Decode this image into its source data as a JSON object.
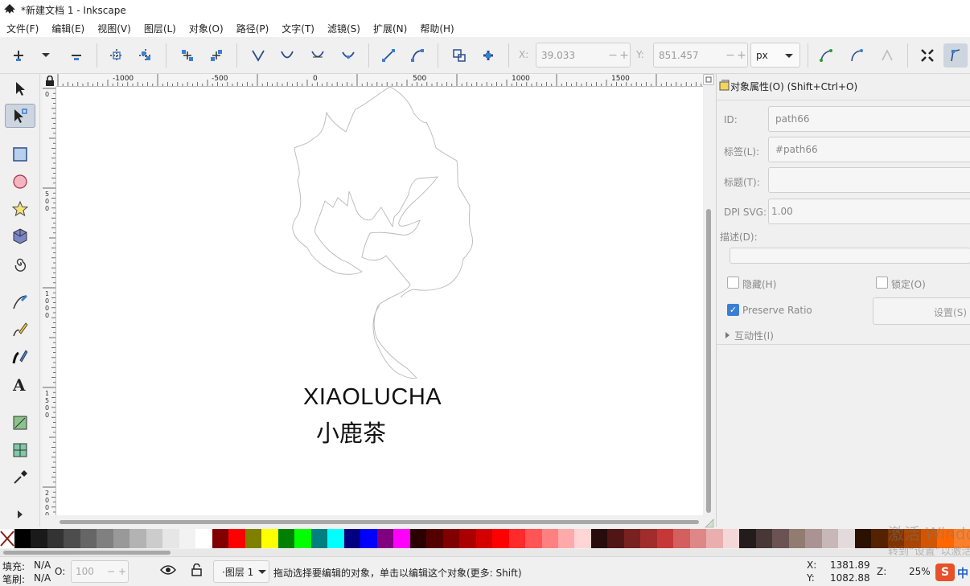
{
  "window": {
    "title": "*新建文档 1 - Inkscape"
  },
  "menu": [
    "文件(F)",
    "编辑(E)",
    "视图(V)",
    "图层(L)",
    "对象(O)",
    "路径(P)",
    "文字(T)",
    "滤镜(S)",
    "扩展(N)",
    "帮助(H)"
  ],
  "toolbar": {
    "x_label": "X:",
    "x_value": "39.033",
    "y_label": "Y:",
    "y_value": "851.457",
    "unit": "px",
    "spin_minus": "−",
    "spin_plus": "+"
  },
  "ruler": {
    "h_ticks": [
      "-1000",
      "-500",
      "0",
      "500",
      "1000",
      "1500"
    ],
    "v_ticks": [
      "0",
      "500",
      "1000",
      "1500",
      "2000"
    ]
  },
  "canvas": {
    "text_en": "XIAOLUCHA",
    "text_cn": "小鹿茶"
  },
  "panel": {
    "header": "对象属性(O) (Shift+Ctrl+O)",
    "id_label": "ID:",
    "id_value": "path66",
    "label_label": "标签(L):",
    "label_value": "#path66",
    "title_label": "标题(T):",
    "title_value": "",
    "dpi_label": "DPI SVG:",
    "dpi_value": "1.00",
    "desc_label": "描述(D):",
    "hide_label": "隐藏(H)",
    "lock_label": "锁定(O)",
    "preserve_label": "Preserve Ratio",
    "settings_label": "设置(S)",
    "interactivity_label": "互动性(I)"
  },
  "status": {
    "fill_label": "填充:",
    "fill_value": "N/A",
    "stroke_label": "笔刷:",
    "stroke_value": "N/A",
    "opacity_label": "O:",
    "opacity_value": "100",
    "layer": "·图层 1",
    "message": "拖动选择要编辑的对象，单击以编辑这个对象(更多: Shift)",
    "cx_label": "X:",
    "cx_value": "1381.89",
    "cy_label": "Y:",
    "cy_value": "1082.88",
    "zoom_label": "Z:",
    "zoom_value": "25%",
    "ime": "中",
    "watermark": "激活 Windows",
    "watermark2": "转到“设置”以激活"
  },
  "colors": {
    "accent": "#3a7fd4",
    "palette": [
      "#000000",
      "#1a1a1a",
      "#333333",
      "#4d4d4d",
      "#666666",
      "#808080",
      "#999999",
      "#b3b3b3",
      "#cccccc",
      "#e6e6e6",
      "#f2f2f2",
      "#ffffff",
      "#800000",
      "#ff0000",
      "#808000",
      "#ffff00",
      "#008000",
      "#00ff00",
      "#008080",
      "#00ffff",
      "#000080",
      "#0000ff",
      "#800080",
      "#ff00ff",
      "#2b0000",
      "#550000",
      "#800000",
      "#aa0000",
      "#d40000",
      "#ff0000",
      "#ff2a2a",
      "#ff5555",
      "#ff8080",
      "#ffaaaa",
      "#ffd5d5",
      "#280b0b",
      "#501616",
      "#782121",
      "#a02c2c",
      "#c83737",
      "#d35f5f",
      "#de8787",
      "#e9afaf",
      "#f4d7d7",
      "#241c1c",
      "#483737",
      "#6c5353",
      "#917c6f",
      "#ac9393",
      "#c8b7b7",
      "#e3dbdb",
      "#2b1100",
      "#552200",
      "#803300",
      "#aa4400",
      "#d45500",
      "#ff6600",
      "#ff7f2a"
    ]
  }
}
